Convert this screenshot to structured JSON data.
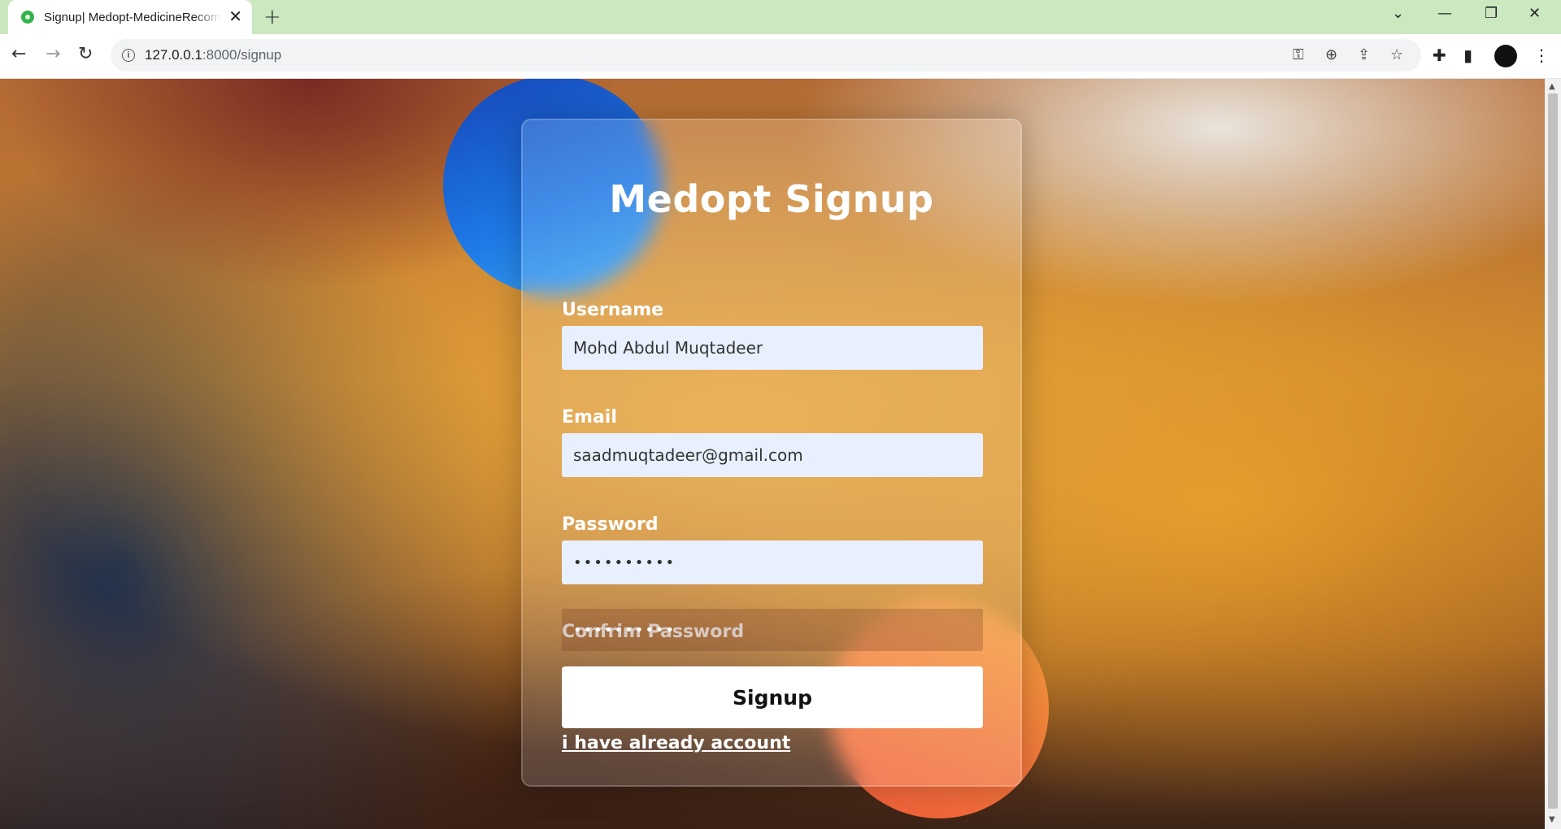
{
  "browser": {
    "tab_title": "Signup| Medopt-MedicineRecommendation",
    "tab_close": "✕",
    "new_tab": "+",
    "url_host": "127.0.0.1",
    "url_path": ":8000/signup",
    "icons": {
      "back": "arrow-left-icon",
      "forward": "arrow-right-icon",
      "reload": "reload-icon",
      "site_info": "info-icon",
      "key": "key-icon",
      "zoom": "zoom-icon",
      "share": "share-icon",
      "bookmark": "star-icon",
      "extensions": "puzzle-icon",
      "side_panel": "side-panel-icon",
      "menu": "kebab-menu-icon"
    },
    "tabstrip_color": "#cbe8c0"
  },
  "form": {
    "title": "Medopt Signup",
    "username": {
      "label": "Username",
      "value": "Mohd Abdul Muqtadeer"
    },
    "email": {
      "label": "Email",
      "value": "saadmuqtadeer@gmail.com"
    },
    "password": {
      "label": "Password",
      "value": "••••••••••"
    },
    "confirm_password": {
      "label": "Confrim Password",
      "value": "••••••••••"
    },
    "submit_label": "Signup",
    "login_link": "i have already account"
  },
  "colors": {
    "blob_top": "#1d79e6",
    "blob_bottom": "#f27a3c",
    "autofill_bg": "#e8f0fe"
  }
}
